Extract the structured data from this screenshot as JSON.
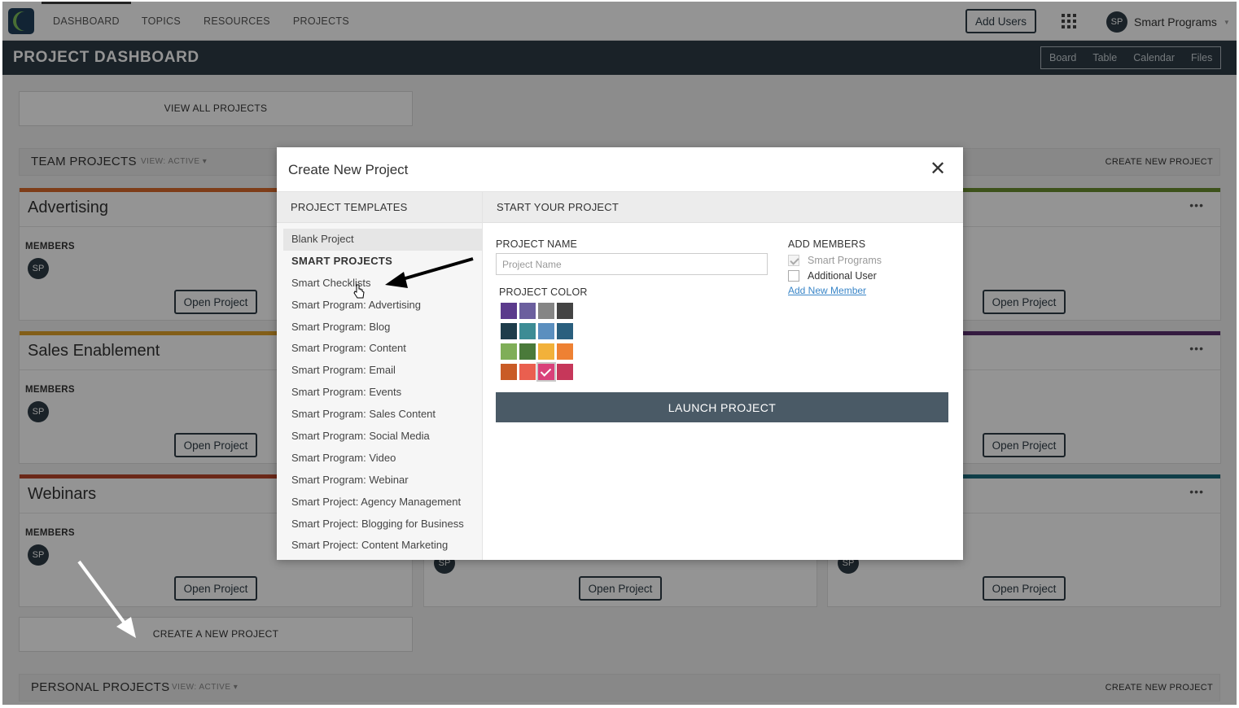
{
  "nav": {
    "links": [
      "DASHBOARD",
      "TOPICS",
      "RESOURCES",
      "PROJECTS"
    ],
    "add_users_label": "Add Users",
    "user": {
      "initials": "SP",
      "name": "Smart Programs"
    }
  },
  "dashboard": {
    "title": "PROJECT DASHBOARD",
    "views": [
      "Board",
      "Table",
      "Calendar",
      "Files"
    ],
    "view_all_label": "VIEW ALL PROJECTS",
    "team_section": {
      "title": "TEAM PROJECTS",
      "view": "VIEW: ACTIVE ▾",
      "create_label": "CREATE NEW PROJECT"
    },
    "personal_section": {
      "title": "PERSONAL PROJECTS",
      "view": "VIEW: ACTIVE ▾",
      "create_label": "CREATE NEW PROJECT"
    },
    "create_new_label": "CREATE A NEW PROJECT",
    "members_label": "MEMBERS",
    "open_label": "Open Project",
    "more_label": "•••",
    "cards": [
      {
        "title": "Advertising",
        "color": "#d96a2b",
        "initials": "SP"
      },
      {
        "title": "Sales Enablement",
        "color": "#e0a32a",
        "initials": "SP"
      },
      {
        "title": "Webinars",
        "color": "#b9452a",
        "initials": "SP"
      },
      {
        "title": "",
        "color": "#6a8e2f",
        "initials": "SP"
      },
      {
        "title": "",
        "color": "#5a2f6e",
        "initials": "SP"
      },
      {
        "title": "",
        "color": "#1d6b7c",
        "initials": "SP"
      },
      {
        "title": "",
        "color": "#ffffff",
        "initials": "SP"
      }
    ]
  },
  "modal": {
    "title": "Create New Project",
    "close_glyph": "✕",
    "templates_header": "PROJECT TEMPLATES",
    "start_header": "START YOUR PROJECT",
    "templates": [
      "Blank Project",
      "SMART PROJECTS",
      "Smart Checklists",
      "Smart Program: Advertising",
      "Smart Program: Blog",
      "Smart Program: Content",
      "Smart Program: Email",
      "Smart Program: Events",
      "Smart Program: Sales Content",
      "Smart Program: Social Media",
      "Smart Program: Video",
      "Smart Program: Webinar",
      "Smart Project: Agency Management",
      "Smart Project: Blogging for Business",
      "Smart Project: Content Marketing"
    ],
    "project_name_label": "PROJECT NAME",
    "project_name_placeholder": "Project Name",
    "project_color_label": "PROJECT COLOR",
    "colors": [
      "#5b3a8c",
      "#6b5f9e",
      "#858585",
      "#444444",
      "#1e3d4b",
      "#3d8c95",
      "#5b8fbf",
      "#2a5f7e",
      "#7fae58",
      "#4a7a3a",
      "#f2b13a",
      "#ee8133",
      "#c95b26",
      "#ea5f4f",
      "#d9417a",
      "#c6375a"
    ],
    "selected_color_index": 14,
    "add_members_label": "ADD MEMBERS",
    "members": [
      {
        "label": "Smart Programs",
        "checked": true
      },
      {
        "label": "Additional User",
        "checked": false
      }
    ],
    "add_new_member_label": "Add New Member",
    "launch_label": "LAUNCH PROJECT"
  }
}
